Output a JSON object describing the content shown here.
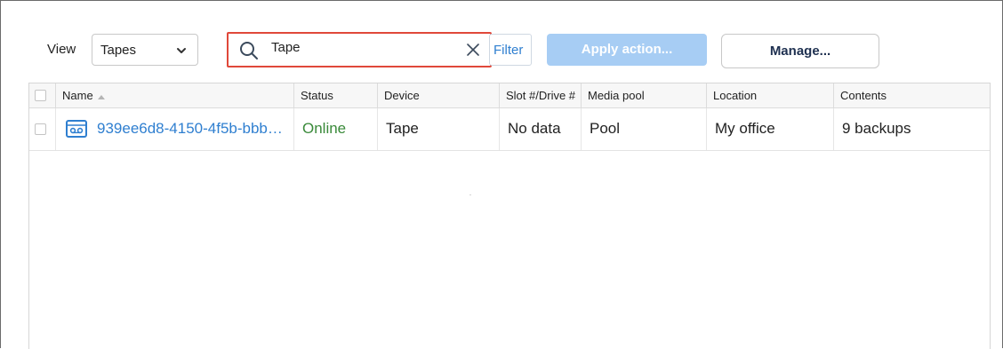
{
  "toolbar": {
    "view_label": "View",
    "view_value": "Tapes",
    "search_value": "Tape",
    "filter_label": "Filter",
    "apply_label": "Apply action...",
    "manage_label": "Manage..."
  },
  "columns": {
    "name": "Name",
    "status": "Status",
    "device": "Device",
    "slot": "Slot #/Drive #",
    "media_pool": "Media pool",
    "location": "Location",
    "contents": "Contents"
  },
  "rows": [
    {
      "name": "939ee6d8-4150-4f5b-bbb…",
      "status": "Online",
      "device": "Tape",
      "slot": "No data",
      "media_pool": "Pool",
      "location": "My office",
      "contents": "9 backups"
    }
  ],
  "icons": {
    "view_dropdown": "chevron-down-icon",
    "search": "search-icon",
    "clear": "close-icon",
    "sort": "sort-ascending-icon",
    "tape": "tape-cassette-icon"
  },
  "colors": {
    "accent": "#2f7fd0",
    "search_border": "#e0483a",
    "apply_disabled": "#a7cdf4",
    "online": "#3a8a3a"
  }
}
